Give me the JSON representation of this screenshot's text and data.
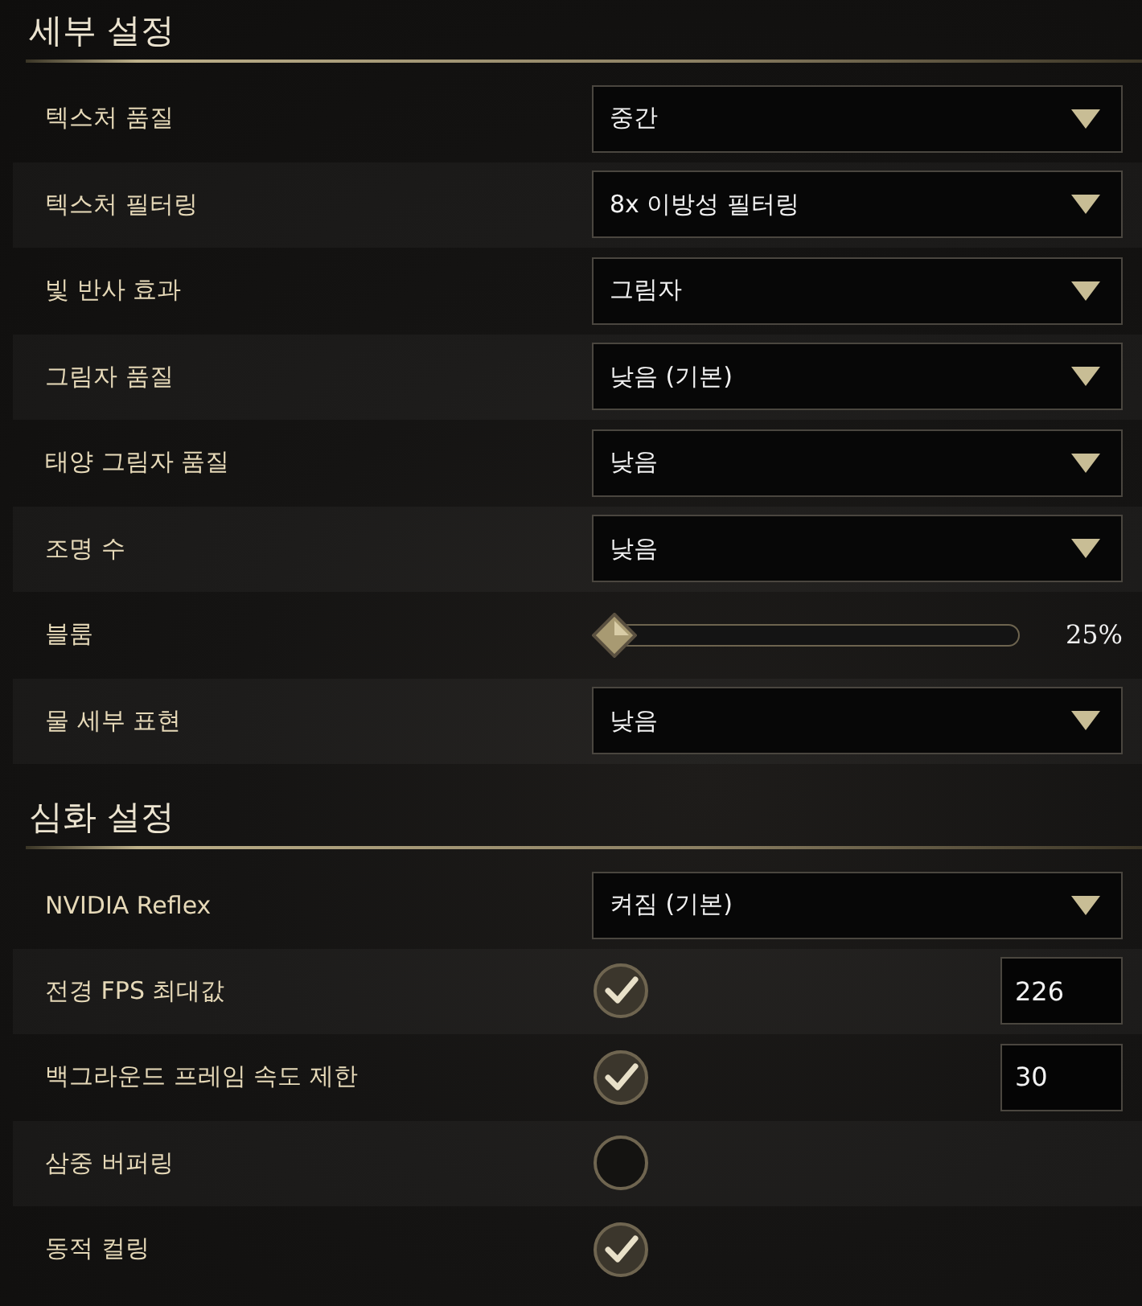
{
  "sections": [
    {
      "title": "세부 설정",
      "rows": [
        {
          "kind": "dropdown",
          "label": "텍스처 품질",
          "value": "중간"
        },
        {
          "kind": "dropdown",
          "label": "텍스처 필터링",
          "value": "8x 이방성 필터링"
        },
        {
          "kind": "dropdown",
          "label": "빛 반사 효과",
          "value": "그림자"
        },
        {
          "kind": "dropdown",
          "label": "그림자 품질",
          "value": "낮음 (기본)"
        },
        {
          "kind": "dropdown",
          "label": "태양 그림자 품질",
          "value": "낮음"
        },
        {
          "kind": "dropdown",
          "label": "조명 수",
          "value": "낮음"
        },
        {
          "kind": "slider",
          "label": "블룸",
          "level": 0,
          "reading": "25%"
        },
        {
          "kind": "dropdown",
          "label": "물 세부 표현",
          "value": "낮음"
        }
      ]
    },
    {
      "title": "심화 설정",
      "rows": [
        {
          "kind": "dropdown",
          "label": "NVIDIA Reflex",
          "value": "켜짐 (기본)"
        },
        {
          "kind": "check_number",
          "label": "전경 FPS 최대값",
          "checked": true,
          "value": "226"
        },
        {
          "kind": "check_number",
          "label": "백그라운드 프레임 속도 제한",
          "checked": true,
          "value": "30"
        },
        {
          "kind": "check",
          "label": "삼중 버퍼링",
          "checked": false
        },
        {
          "kind": "check",
          "label": "동적 컬링",
          "checked": true
        }
      ]
    }
  ]
}
